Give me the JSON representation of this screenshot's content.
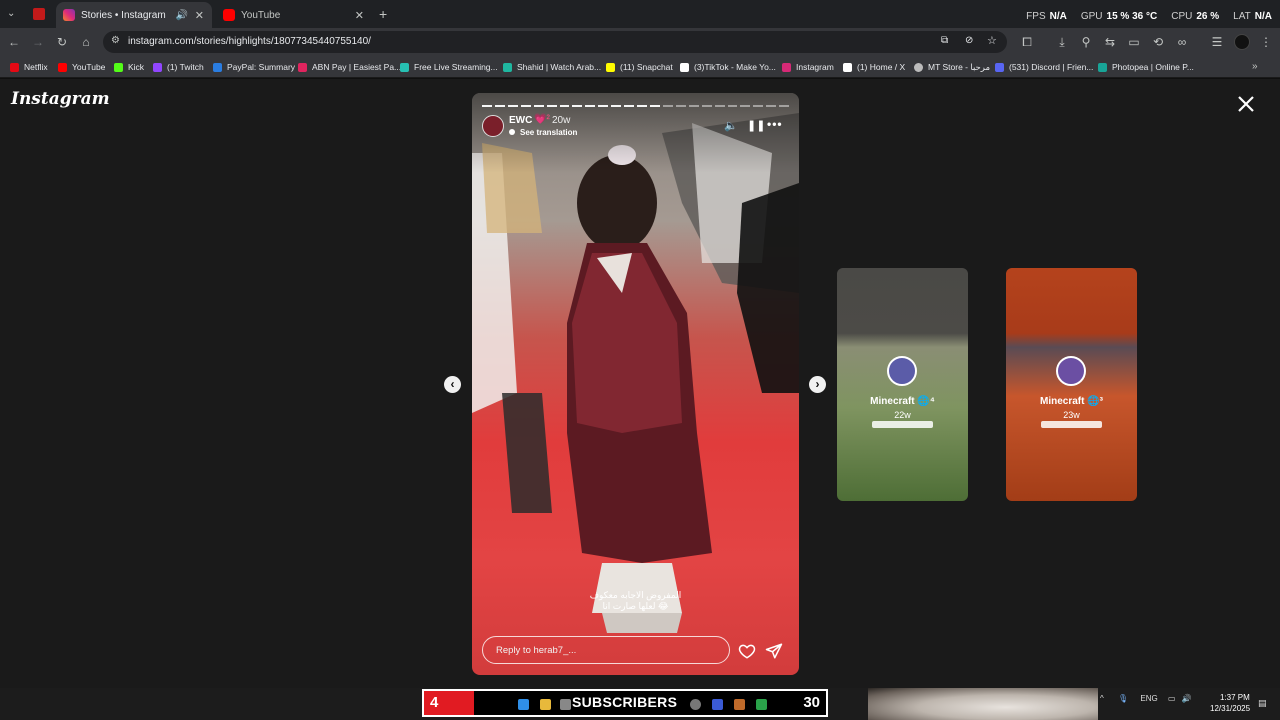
{
  "browser": {
    "tabs": [
      {
        "title": "Stories • Instagram",
        "active": true
      },
      {
        "title": "YouTube",
        "active": false
      }
    ],
    "url": "instagram.com/stories/highlights/18077345440755140/",
    "bookmarks": [
      {
        "label": "Netflix",
        "color": "#e50914"
      },
      {
        "label": "YouTube",
        "color": "#ff0000"
      },
      {
        "label": "Kick",
        "color": "#53fc18"
      },
      {
        "label": "(1) Twitch",
        "color": "#9146ff"
      },
      {
        "label": "PayPal: Summary",
        "color": "#2a7de1"
      },
      {
        "label": "ABN Pay | Easiest Pa...",
        "color": "#e0245e"
      },
      {
        "label": "Free Live Streaming...",
        "color": "#27c0b3"
      },
      {
        "label": "Shahid | Watch Arab...",
        "color": "#1fb7a0"
      },
      {
        "label": "(11) Snapchat",
        "color": "#fffc00"
      },
      {
        "label": "(3)TikTok - Make Yo...",
        "color": "#ffffff"
      },
      {
        "label": "Instagram",
        "color": "#d62976"
      },
      {
        "label": "(1) Home / X",
        "color": "#ffffff"
      },
      {
        "label": "MT Store - مرحبا",
        "color": "#bbbbbb"
      },
      {
        "label": "(531) Discord | Frien...",
        "color": "#5865f2"
      },
      {
        "label": "Photopea | Online P...",
        "color": "#18a497"
      }
    ]
  },
  "overlay": {
    "fps_label": "FPS",
    "fps_value": "N/A",
    "gpu_label": "GPU",
    "gpu_value": "15 % 36 °C",
    "cpu_label": "CPU",
    "cpu_value": "26 %",
    "lat_label": "LAT",
    "lat_value": "N/A"
  },
  "instagram": {
    "logo": "Instagram",
    "story": {
      "username": "EWC",
      "badge": "💗²",
      "time": "20w",
      "see_translation": "See translation",
      "caption_line1": "المفروض الاجابه معكوف",
      "caption_line2": "لعلها صارت انا 😂",
      "reply_placeholder": "Reply to herab7_...",
      "progress_total": 24,
      "progress_done": 14
    },
    "previews": [
      {
        "name": "Minecraft 🌐⁴",
        "time": "22w"
      },
      {
        "name": "Minecraft 🌐³",
        "time": "23w"
      }
    ]
  },
  "taskbar": {
    "sub_left": "4",
    "sub_label": "SUBSCRIBERS",
    "sub_right": "30",
    "tray_lang": "ENG",
    "time": "1:37 PM",
    "date": "12/31/2025"
  }
}
